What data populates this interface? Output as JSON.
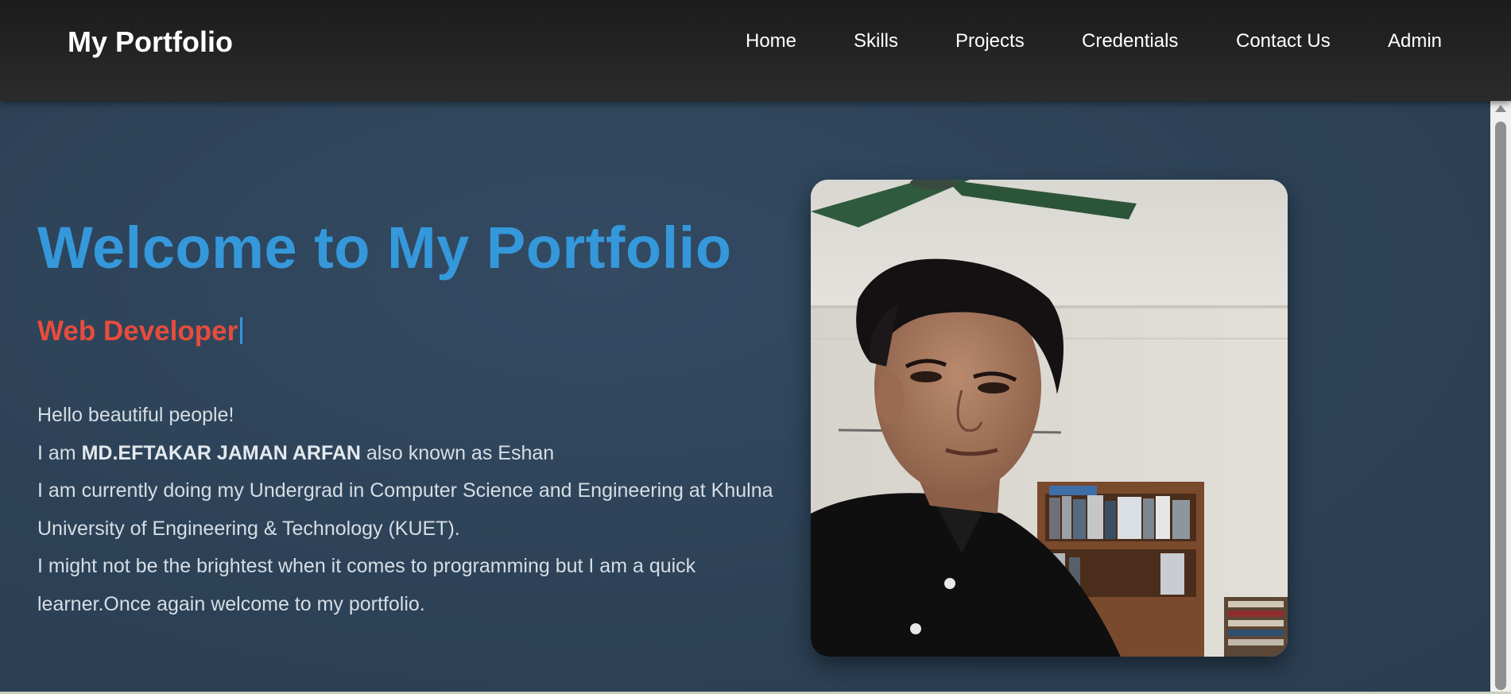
{
  "navbar": {
    "brand": "My Portfolio",
    "links": [
      {
        "label": "Home"
      },
      {
        "label": "Skills"
      },
      {
        "label": "Projects"
      },
      {
        "label": "Credentials"
      },
      {
        "label": "Contact Us"
      },
      {
        "label": "Admin"
      }
    ]
  },
  "hero": {
    "title": "Welcome to My Portfolio",
    "subtitle": "Web Developer",
    "intro": {
      "greeting": "Hello beautiful people!",
      "name_prefix": "I am ",
      "name": "MD.EFTAKAR JAMAN ARFAN",
      "name_suffix": " also known as Eshan",
      "education": "I am currently doing my Undergrad in Computer Science and Engineering at Khulna University of Engineering & Technology (KUET).",
      "closing": "I might not be the brightest when it comes to programming but I am a quick learner.Once again welcome to my portfolio."
    }
  },
  "colors": {
    "title": "#3498db",
    "subtitle": "#e74c3c",
    "hero_bg": "#2c3e50",
    "nav_bg": "#222222"
  }
}
